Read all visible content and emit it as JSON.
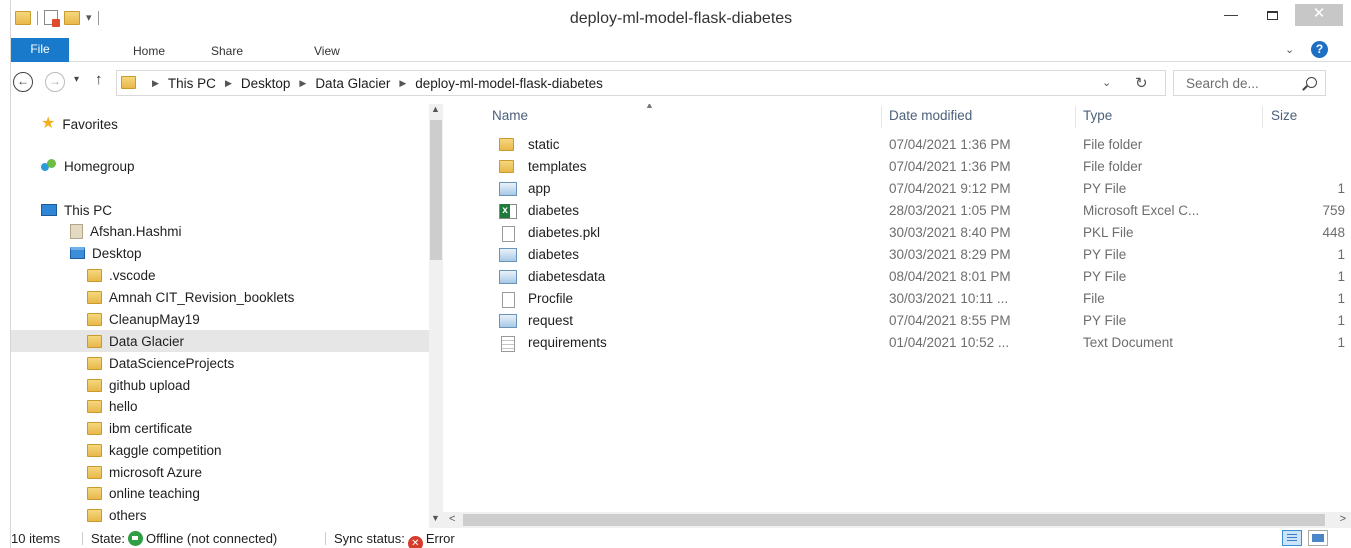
{
  "window": {
    "title": "deploy-ml-model-flask-diabetes"
  },
  "ribbon": {
    "tabs": [
      "File",
      "Home",
      "Share",
      "View"
    ]
  },
  "address": {
    "crumbs": [
      "This PC",
      "Desktop",
      "Data Glacier",
      "deploy-ml-model-flask-diabetes"
    ],
    "search_placeholder": "Search de..."
  },
  "navpane": {
    "favorites": "Favorites",
    "homegroup": "Homegroup",
    "this_pc": "This PC",
    "user_folder": "Afshan.Hashmi",
    "desktop": "Desktop",
    "folders": [
      ".vscode",
      "Amnah CIT_Revision_booklets",
      "CleanupMay19",
      "Data Glacier",
      "DataScienceProjects",
      "github upload",
      "hello",
      "ibm certificate",
      "kaggle competition",
      "microsoft Azure",
      "online teaching",
      "others"
    ],
    "selected_folder": "Data Glacier"
  },
  "columns": {
    "name": "Name",
    "date": "Date modified",
    "type": "Type",
    "size": "Size"
  },
  "files": [
    {
      "icon": "folder-icon",
      "name": "static",
      "date": "07/04/2021 1:36 PM",
      "type": "File folder",
      "size": ""
    },
    {
      "icon": "folder-icon",
      "name": "templates",
      "date": "07/04/2021 1:36 PM",
      "type": "File folder",
      "size": ""
    },
    {
      "icon": "python-file-icon",
      "name": "app",
      "date": "07/04/2021 9:12 PM",
      "type": "PY File",
      "size": "1"
    },
    {
      "icon": "excel-file-icon",
      "name": "diabetes",
      "date": "28/03/2021 1:05 PM",
      "type": "Microsoft Excel C...",
      "size": "759"
    },
    {
      "icon": "generic-file-icon",
      "name": "diabetes.pkl",
      "date": "30/03/2021 8:40 PM",
      "type": "PKL File",
      "size": "448"
    },
    {
      "icon": "python-file-icon",
      "name": "diabetes",
      "date": "30/03/2021 8:29 PM",
      "type": "PY File",
      "size": "1"
    },
    {
      "icon": "python-file-icon",
      "name": "diabetesdata",
      "date": "08/04/2021 8:01 PM",
      "type": "PY File",
      "size": "1"
    },
    {
      "icon": "generic-file-icon",
      "name": "Procfile",
      "date": "30/03/2021 10:11 ...",
      "type": "File",
      "size": "1"
    },
    {
      "icon": "python-file-icon",
      "name": "request",
      "date": "07/04/2021 8:55 PM",
      "type": "PY File",
      "size": "1"
    },
    {
      "icon": "text-file-icon",
      "name": "requirements",
      "date": "01/04/2021 10:52 ...",
      "type": "Text Document",
      "size": "1"
    }
  ],
  "status": {
    "items": "10 items",
    "state_label": "State:",
    "state_value": "Offline (not connected)",
    "sync_label": "Sync status:",
    "sync_value": "Error"
  }
}
